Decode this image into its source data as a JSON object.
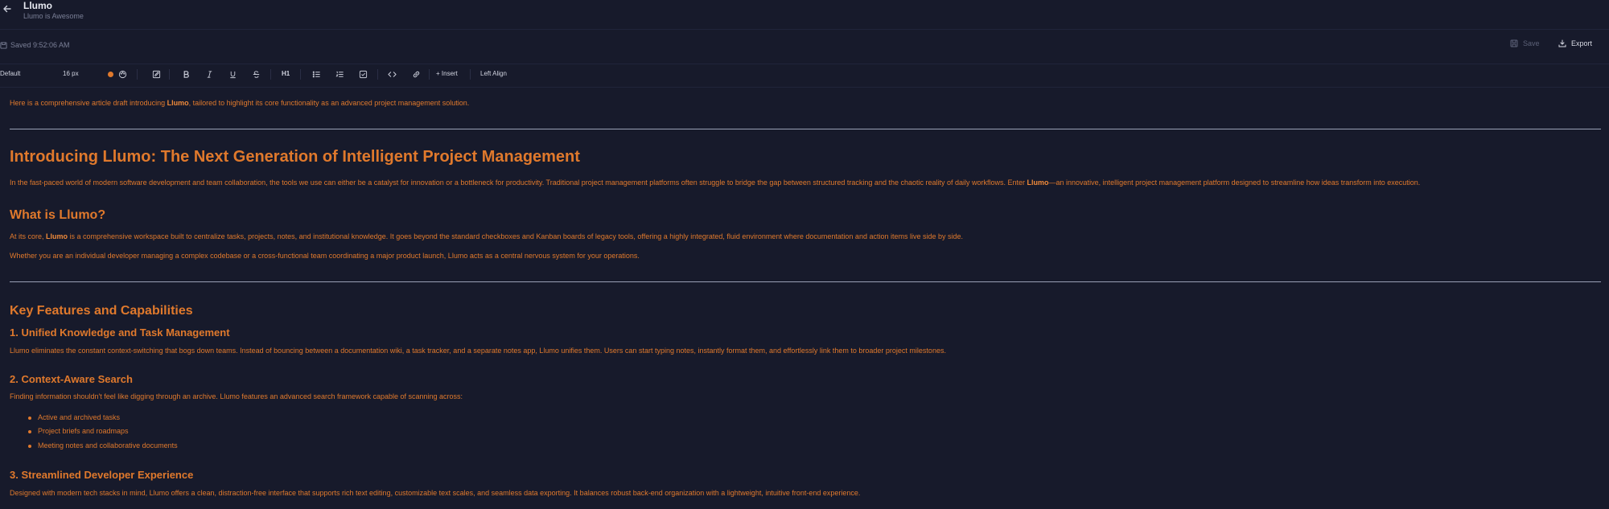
{
  "header": {
    "title": "Llumo",
    "subtitle": "Llumo is Awesome",
    "back_icon": "arrow-left-icon"
  },
  "status": {
    "saved_text": "Saved 9:52:06 AM",
    "save_label": "Save",
    "export_label": "Export"
  },
  "toolbar": {
    "style_select": "Default",
    "font_size": "16 px",
    "text_color": "#e0792c",
    "heading_label": "H1",
    "insert_label": "+ Insert",
    "align_label": "Left Align"
  },
  "doc": {
    "intro_a": "Here is a comprehensive article draft introducing ",
    "intro_b": "Llumo",
    "intro_c": ", tailored to highlight its core functionality as an advanced project management solution.",
    "h1": "Introducing Llumo: The Next Generation of Intelligent Project Management",
    "p1_a": "In the fast-paced world of modern software development and team collaboration, the tools we use can either be a catalyst for innovation or a bottleneck for productivity. Traditional project management platforms often struggle to bridge the gap between structured tracking and the chaotic reality of daily workflows. Enter ",
    "p1_b": "Llumo",
    "p1_c": "—an innovative, intelligent project management platform designed to streamline how ideas transform into execution.",
    "h2_what": "What is Llumo?",
    "p2_a": "At its core, ",
    "p2_b": "Llumo",
    "p2_c": " is a comprehensive workspace built to centralize tasks, projects, notes, and institutional knowledge. It goes beyond the standard checkboxes and Kanban boards of legacy tools, offering a highly integrated, fluid environment where documentation and action items live side by side.",
    "p3": "Whether you are an individual developer managing a complex codebase or a cross-functional team coordinating a major product launch, Llumo acts as a central nervous system for your operations.",
    "h2_key": "Key Features and Capabilities",
    "h3_1": "1. Unified Knowledge and Task Management",
    "p4": "Llumo eliminates the constant context-switching that bogs down teams. Instead of bouncing between a documentation wiki, a task tracker, and a separate notes app, Llumo unifies them. Users can start typing notes, instantly format them, and effortlessly link them to broader project milestones.",
    "h3_2": "2. Context-Aware Search",
    "p5": "Finding information shouldn't feel like digging through an archive. Llumo features an advanced search framework capable of scanning across:",
    "bullets": [
      "Active and archived tasks",
      "Project briefs and roadmaps",
      "Meeting notes and collaborative documents"
    ],
    "h3_3": "3. Streamlined Developer Experience",
    "p6": "Designed with modern tech stacks in mind, Llumo offers a clean, distraction-free interface that supports rich text editing, customizable text scales, and seamless data exporting. It balances robust back-end organization with a lightweight, intuitive front-end experience."
  }
}
